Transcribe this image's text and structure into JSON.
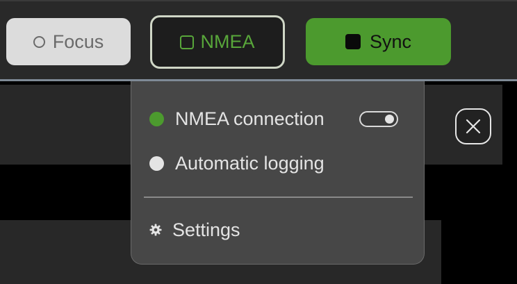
{
  "toolbar": {
    "focus_label": "Focus",
    "nmea_label": "NMEA",
    "sync_label": "Sync",
    "focus_icon": "circle-outline-icon",
    "nmea_icon": "square-outline-icon",
    "sync_icon": "square-filled-icon"
  },
  "dropdown": {
    "items": [
      {
        "label": "NMEA connection",
        "status_icon": "status-dot-icon",
        "status_color": "#4c9a2e",
        "toggle_on": true
      },
      {
        "label": "Automatic logging",
        "status_icon": "status-dot-icon",
        "status_color": "#e4e4e4"
      },
      {
        "label": "Settings",
        "icon": "gear-icon"
      }
    ]
  },
  "close_icon": "close-icon",
  "colors": {
    "accent_green": "#4c9a2e",
    "nmea_text_green": "#58a63a",
    "toolbar_bg": "#292929",
    "dropdown_bg": "#474747"
  }
}
